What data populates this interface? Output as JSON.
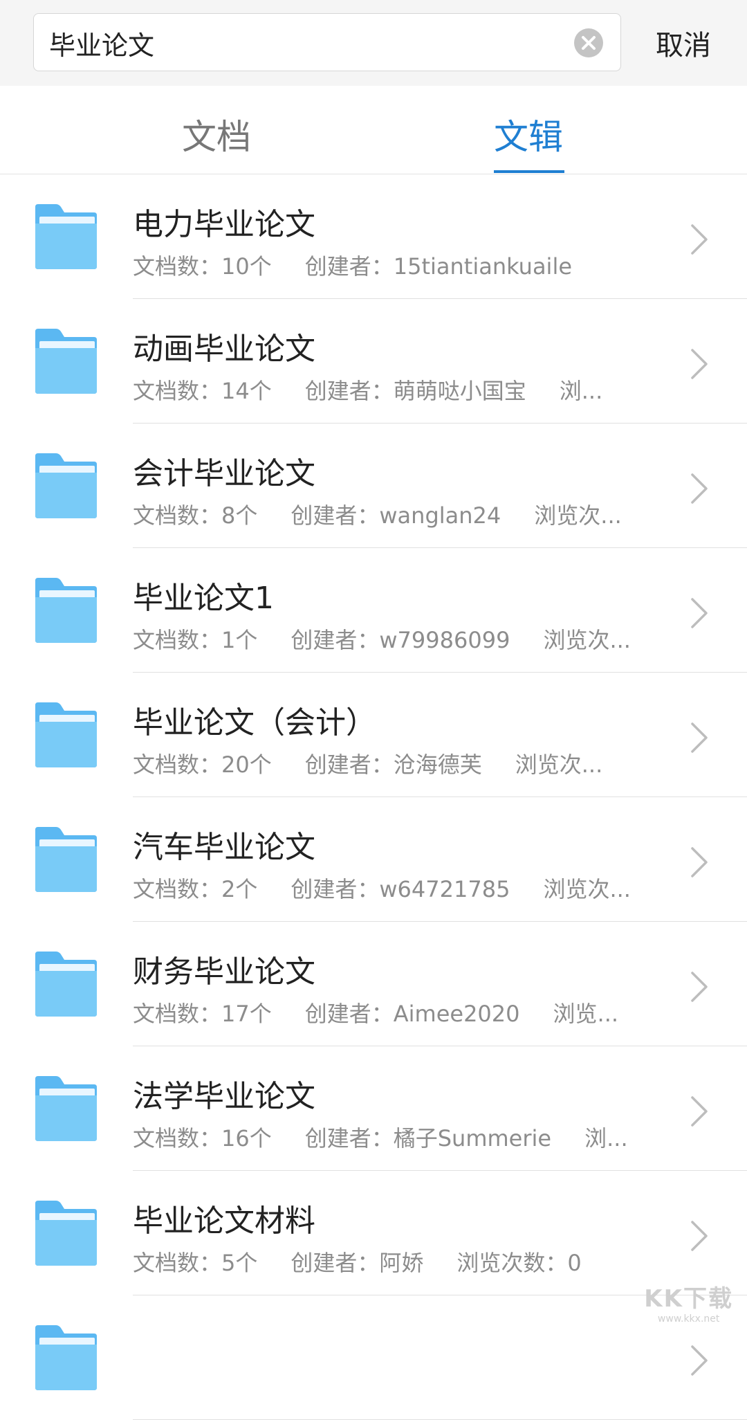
{
  "search": {
    "value": "毕业论文",
    "cancel_label": "取消"
  },
  "tabs": [
    {
      "label": "文档",
      "active": false
    },
    {
      "label": "文辑",
      "active": true
    }
  ],
  "colors": {
    "accent": "#1f7fd2",
    "folder": "#6fc3f5"
  },
  "collections": [
    {
      "title": "电力毕业论文",
      "docs": "文档数：10个",
      "creator": "创建者：15tiantiankuaile",
      "views": ""
    },
    {
      "title": "动画毕业论文",
      "docs": "文档数：14个",
      "creator": "创建者：萌萌哒小国宝",
      "views": "浏..."
    },
    {
      "title": "会计毕业论文",
      "docs": "文档数：8个",
      "creator": "创建者：wanglan24",
      "views": "浏览次..."
    },
    {
      "title": "毕业论文1",
      "docs": "文档数：1个",
      "creator": "创建者：w79986099",
      "views": "浏览次..."
    },
    {
      "title": "毕业论文（会计）",
      "docs": "文档数：20个",
      "creator": "创建者：沧海德芙",
      "views": "浏览次..."
    },
    {
      "title": "汽车毕业论文",
      "docs": "文档数：2个",
      "creator": "创建者：w64721785",
      "views": "浏览次..."
    },
    {
      "title": "财务毕业论文",
      "docs": "文档数：17个",
      "creator": "创建者：Aimee2020",
      "views": "浏览..."
    },
    {
      "title": "法学毕业论文",
      "docs": "文档数：16个",
      "creator": "创建者：橘子Summerie",
      "views": "浏..."
    },
    {
      "title": "毕业论文材料",
      "docs": "文档数：5个",
      "creator": "创建者：阿娇",
      "views": "浏览次数：0"
    },
    {
      "title": "",
      "docs": "",
      "creator": "",
      "views": ""
    }
  ],
  "watermark": {
    "big": "KK下载",
    "small": "www.kkx.net"
  }
}
